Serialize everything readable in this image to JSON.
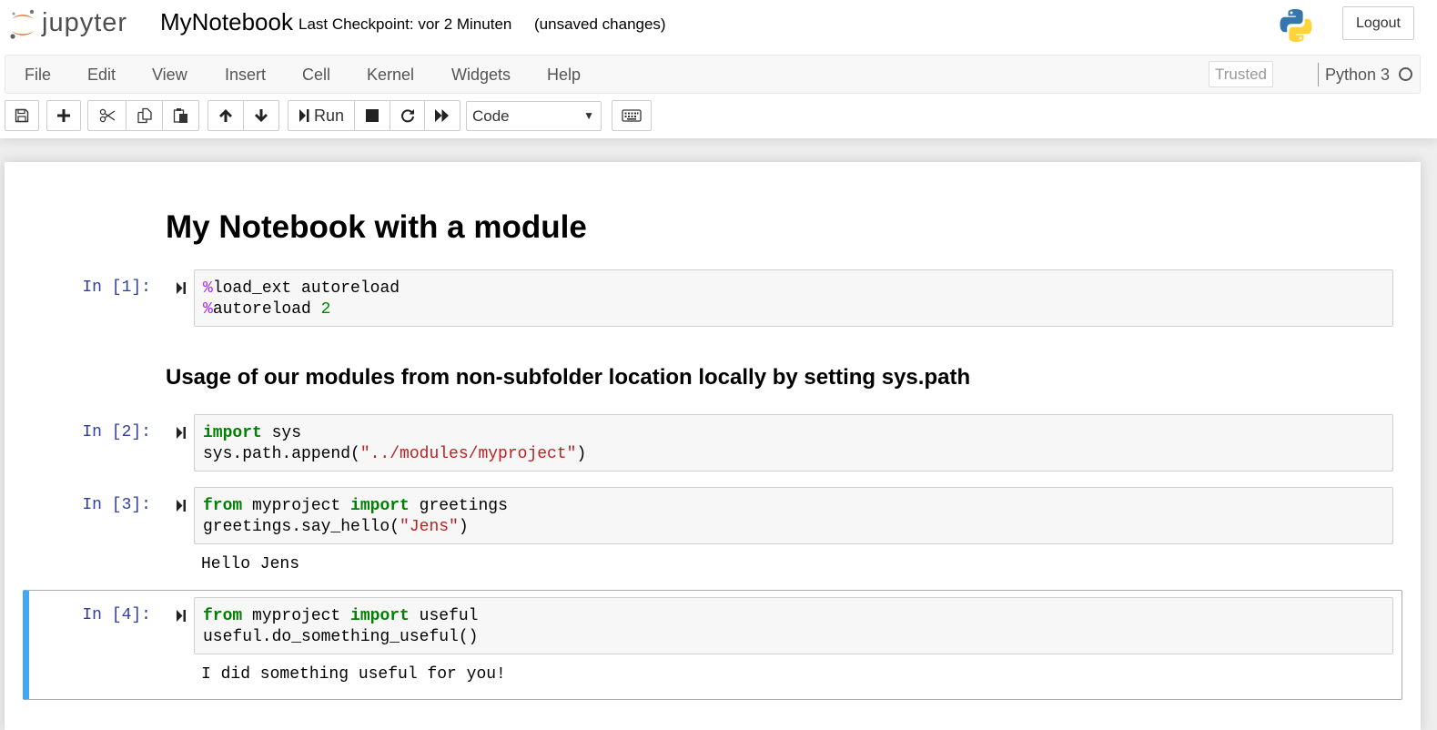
{
  "header": {
    "logo_text": "jupyter",
    "notebook_name": "MyNotebook",
    "checkpoint": "Last Checkpoint: vor 2 Minuten",
    "unsaved": "(unsaved changes)",
    "logout_label": "Logout"
  },
  "menubar": {
    "items": [
      "File",
      "Edit",
      "View",
      "Insert",
      "Cell",
      "Kernel",
      "Widgets",
      "Help"
    ],
    "trusted_label": "Trusted",
    "kernel_name": "Python 3"
  },
  "toolbar": {
    "buttons": [
      {
        "name": "save",
        "icon": "floppy-icon"
      },
      {
        "name": "insert-cell-below",
        "icon": "plus-icon"
      },
      {
        "name": "cut",
        "icon": "scissors-icon"
      },
      {
        "name": "copy",
        "icon": "copy-icon"
      },
      {
        "name": "paste",
        "icon": "paste-icon"
      },
      {
        "name": "move-up",
        "icon": "arrow-up-icon"
      },
      {
        "name": "move-down",
        "icon": "arrow-down-icon"
      },
      {
        "name": "run",
        "icon": "step-forward-icon"
      },
      {
        "name": "interrupt",
        "icon": "stop-icon"
      },
      {
        "name": "restart",
        "icon": "refresh-icon"
      },
      {
        "name": "restart-run-all",
        "icon": "fast-forward-icon"
      },
      {
        "name": "command-palette",
        "icon": "keyboard-icon"
      }
    ],
    "run_label": "Run",
    "cell_type": "Code"
  },
  "notebook": {
    "title": "My Notebook with a module",
    "subtitle": "Usage of our modules from non-subfolder location locally by setting sys.path",
    "cells": [
      {
        "prompt": "In [1]:",
        "lines": [
          "%load_ext autoreload",
          "%autoreload 2"
        ],
        "output": ""
      },
      {
        "prompt": "In [2]:",
        "lines": [
          "import sys",
          "sys.path.append(\"../modules/myproject\")"
        ],
        "output": ""
      },
      {
        "prompt": "In [3]:",
        "lines": [
          "from myproject import greetings",
          "greetings.say_hello(\"Jens\")"
        ],
        "output": "Hello Jens"
      },
      {
        "prompt": "In [4]:",
        "lines": [
          "from myproject import useful",
          "useful.do_something_useful()"
        ],
        "output": "I did something useful for you!"
      }
    ],
    "code_tokens": {
      "c1l1": [
        "%",
        "load_ext autoreload"
      ],
      "c1l2": [
        "%",
        "autoreload ",
        "2"
      ],
      "c2l1": [
        "import",
        " sys"
      ],
      "c2l2": [
        "sys.path.append(",
        "\"../modules/myproject\"",
        ")"
      ],
      "c3l1": [
        "from",
        " myproject ",
        "import",
        " greetings"
      ],
      "c3l2": [
        "greetings.say_hello(",
        "\"Jens\"",
        ")"
      ],
      "c4l1": [
        "from",
        " myproject ",
        "import",
        " useful"
      ],
      "c4l2": [
        "useful.do_something_useful()"
      ]
    }
  },
  "colors": {
    "accent_selected": "#42a5f5",
    "prompt": "#303f9f",
    "keyword": "#008000",
    "magic": "#aa22ff",
    "string": "#ba2121"
  }
}
